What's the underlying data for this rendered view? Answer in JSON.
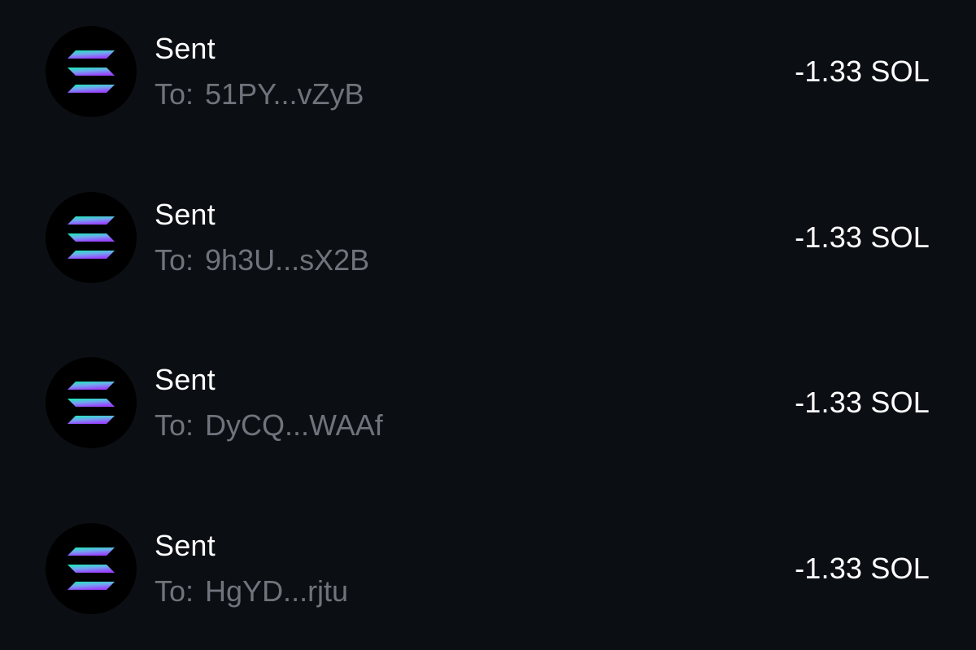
{
  "colors": {
    "background": "#0b0e13",
    "avatar_bg": "#000000",
    "primary_text": "#ffffff",
    "secondary_text": "#6f747c",
    "solana_gradient_top": "#14f1b5",
    "solana_gradient_bottom": "#9945ff"
  },
  "transactions": [
    {
      "type": "Sent",
      "to_label": "To:",
      "address": "51PY...vZyB",
      "amount": "-1.33 SOL",
      "icon": "solana-logo-icon"
    },
    {
      "type": "Sent",
      "to_label": "To:",
      "address": "9h3U...sX2B",
      "amount": "-1.33 SOL",
      "icon": "solana-logo-icon"
    },
    {
      "type": "Sent",
      "to_label": "To:",
      "address": "DyCQ...WAAf",
      "amount": "-1.33 SOL",
      "icon": "solana-logo-icon"
    },
    {
      "type": "Sent",
      "to_label": "To:",
      "address": "HgYD...rjtu",
      "amount": "-1.33 SOL",
      "icon": "solana-logo-icon"
    }
  ]
}
